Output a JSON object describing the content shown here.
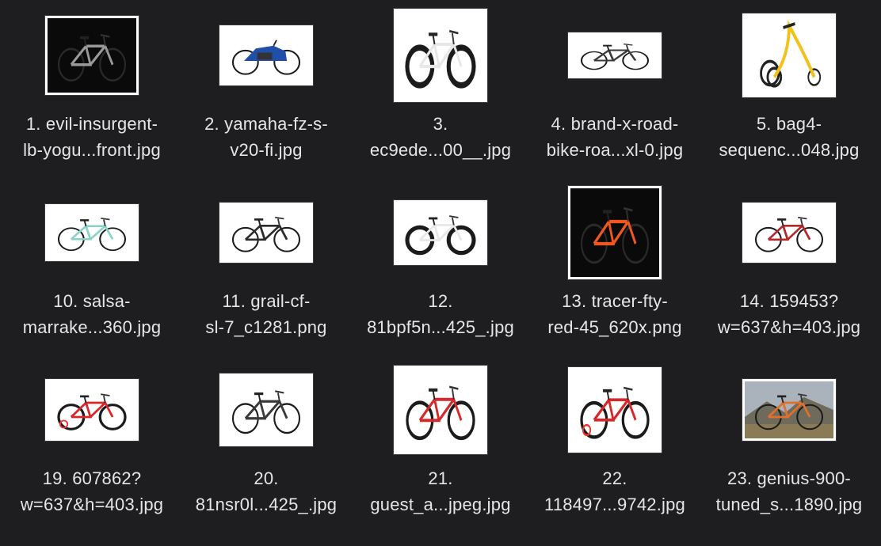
{
  "files": [
    {
      "line1": "1. evil-insurgent-",
      "line2": "lb-yogu...front.jpg",
      "icon": "mountain-bike-photo",
      "bg": "#0a0a0a"
    },
    {
      "line1": "2. yamaha-fz-s-",
      "line2": "v20-fi.jpg",
      "icon": "motorcycle-photo",
      "bg": "#ffffff"
    },
    {
      "line1": "3.",
      "line2": "ec9ede...00__.jpg",
      "icon": "fat-bike-photo",
      "bg": "#ffffff"
    },
    {
      "line1": "4. brand-x-road-",
      "line2": "bike-roa...xl-0.jpg",
      "icon": "road-bike-photo",
      "bg": "#ffffff"
    },
    {
      "line1": "5. bag4-",
      "line2": "sequenc...048.jpg",
      "icon": "trike-scooter-photo",
      "bg": "#ffffff"
    },
    {
      "line1": "10. salsa-",
      "line2": "marrake...360.jpg",
      "icon": "touring-bike-photo",
      "bg": "#ffffff"
    },
    {
      "line1": "11. grail-cf-",
      "line2": "sl-7_c1281.png",
      "icon": "gravel-bike-photo",
      "bg": "#ffffff"
    },
    {
      "line1": "12.",
      "line2": "81bpf5n...425_.jpg",
      "icon": "fat-bike-photo",
      "bg": "#ffffff"
    },
    {
      "line1": "13. tracer-fty-",
      "line2": "red-45_620x.png",
      "icon": "enduro-bike-photo",
      "bg": "#0a0a0a"
    },
    {
      "line1": "14. 159453?",
      "line2": "w=637&h=403.jpg",
      "icon": "hybrid-bike-photo",
      "bg": "#ffffff"
    },
    {
      "line1": "19. 607862?",
      "line2": "w=637&h=403.jpg",
      "icon": "kids-bike-photo",
      "bg": "#ffffff"
    },
    {
      "line1": "20.",
      "line2": "81nsr0l...425_.jpg",
      "icon": "road-bike-photo",
      "bg": "#ffffff"
    },
    {
      "line1": "21.",
      "line2": "guest_a...jpeg.jpg",
      "icon": "bmx-bike-photo",
      "bg": "#ffffff"
    },
    {
      "line1": "22.",
      "line2": "118497...9742.jpg",
      "icon": "kids-bike-photo",
      "bg": "#ffffff"
    },
    {
      "line1": "23. genius-900-",
      "line2": "tuned_s...1890.jpg",
      "icon": "mountain-landscape-bike-photo",
      "bg": "#8a8f94"
    }
  ]
}
